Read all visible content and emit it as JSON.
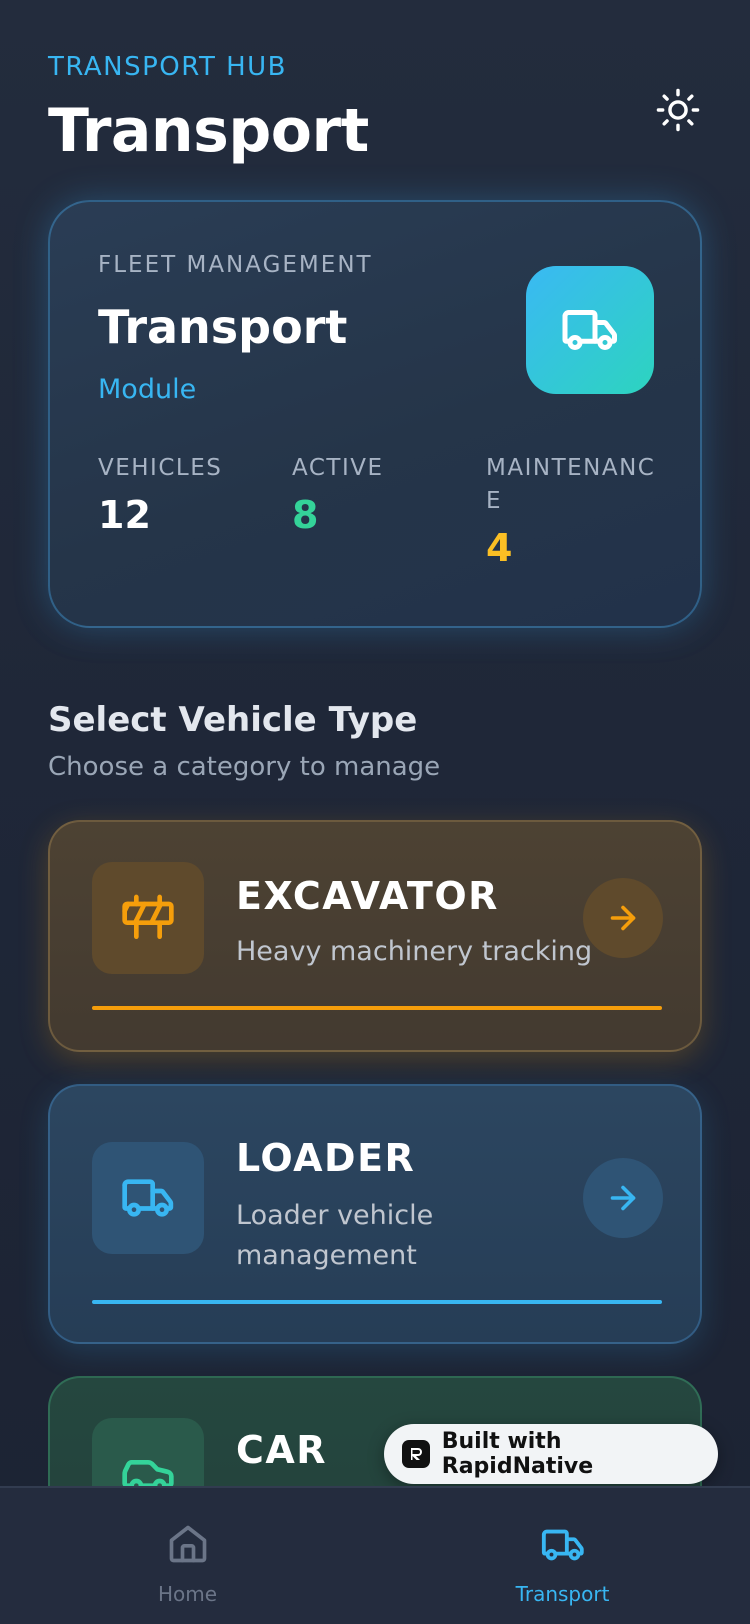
{
  "header": {
    "eyebrow": "TRANSPORT HUB",
    "title": "Transport",
    "theme_icon": "sun-icon"
  },
  "module_card": {
    "eyebrow": "FLEET MANAGEMENT",
    "title": "Transport",
    "subtitle": "Module",
    "icon": "truck-icon",
    "stats": [
      {
        "label": "VEHICLES",
        "value": "12",
        "color": "#ffffff"
      },
      {
        "label": "ACTIVE",
        "value": "8",
        "color": "#34d399"
      },
      {
        "label": "MAINTENANCE",
        "value": "4",
        "color": "#fbbf24"
      }
    ]
  },
  "section": {
    "title": "Select Vehicle Type",
    "subtitle": "Choose a category to manage"
  },
  "vehicle_types": [
    {
      "name": "EXCAVATOR",
      "description": "Heavy machinery tracking",
      "icon": "barrier-icon",
      "accent": "#f59e0b"
    },
    {
      "name": "LOADER",
      "description": "Loader vehicle management",
      "icon": "truck-icon",
      "accent": "#38b6f2"
    },
    {
      "name": "CAR",
      "description": "",
      "icon": "car-icon",
      "accent": "#34d399"
    }
  ],
  "badge": {
    "label": "Built with RapidNative"
  },
  "bottom_nav": {
    "items": [
      {
        "label": "Home",
        "icon": "home-icon",
        "active": false
      },
      {
        "label": "Transport",
        "icon": "truck-icon",
        "active": true
      }
    ]
  },
  "colors": {
    "accent_blue": "#38b6f2",
    "accent_green": "#34d399",
    "accent_yellow": "#fbbf24",
    "accent_orange": "#f59e0b",
    "background": "#1f2738"
  }
}
